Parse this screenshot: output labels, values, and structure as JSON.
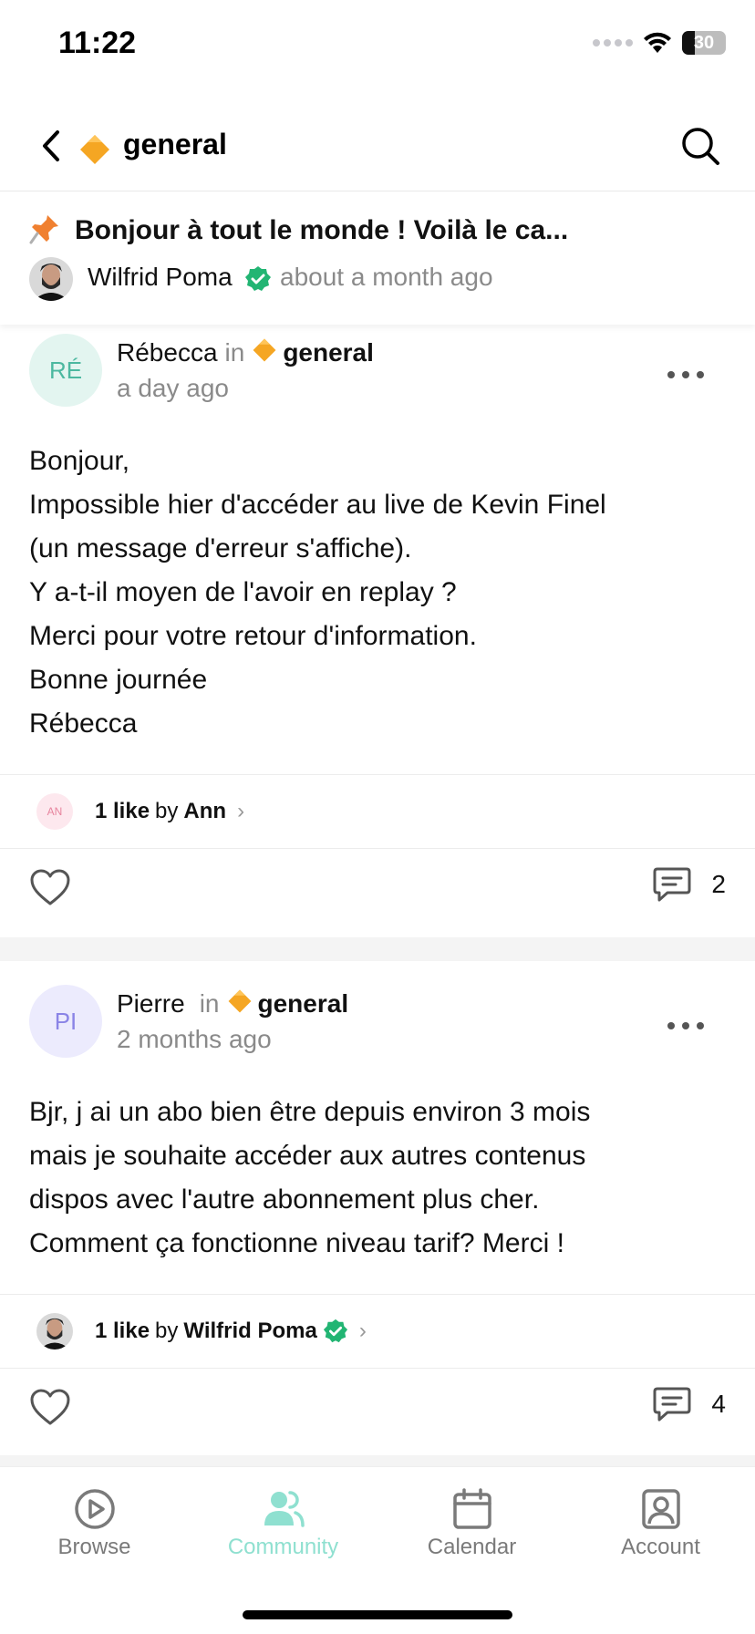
{
  "status_bar": {
    "time": "11:22",
    "battery": "30",
    "battery_level": 0.3
  },
  "header": {
    "title": "general",
    "emoji": "orange-diamond"
  },
  "pinned": {
    "title": "Bonjour à tout le monde ! Voilà le ca...",
    "author": "Wilfrid Poma",
    "time": "about a month ago"
  },
  "posts": [
    {
      "avatar_initials": "RÉ",
      "author": "Rébecca",
      "in": "in",
      "channel": "general",
      "time": "a day ago",
      "body": [
        "Bonjour,",
        "Impossible hier d'accéder au live de Kevin Finel",
        "(un message d'erreur s'affiche).",
        "Y a-t-il moyen de l'avoir en replay ?",
        "Merci pour votre retour d'information.",
        "Bonne journée",
        "Rébecca"
      ],
      "likes": {
        "avatar_initials": "AN",
        "count_label": "1 like",
        "by": "by",
        "liker": "Ann"
      },
      "comments": "2"
    },
    {
      "avatar_initials": "PI",
      "author": "Pierre",
      "in": "in",
      "channel": "general",
      "time": "2 months ago",
      "body": [
        "Bjr, j ai un abo bien être depuis environ 3 mois",
        "mais je souhaite accéder aux autres contenus",
        "dispos avec l'autre abonnement plus cher.",
        "Comment ça fonctionne niveau tarif? Merci !"
      ],
      "likes": {
        "count_label": "1 like",
        "by": "by",
        "liker": "Wilfrid Poma"
      },
      "comments": "4"
    }
  ],
  "tabs": [
    {
      "label": "Browse",
      "icon": "play-circle-icon"
    },
    {
      "label": "Community",
      "icon": "users-icon",
      "active": true
    },
    {
      "label": "Calendar",
      "icon": "calendar-icon"
    },
    {
      "label": "Account",
      "icon": "account-icon"
    }
  ],
  "colors": {
    "accent": "#8fe0d0",
    "verified": "#22b573",
    "diamond": "#f5a623",
    "muted": "#8a8a8a"
  }
}
